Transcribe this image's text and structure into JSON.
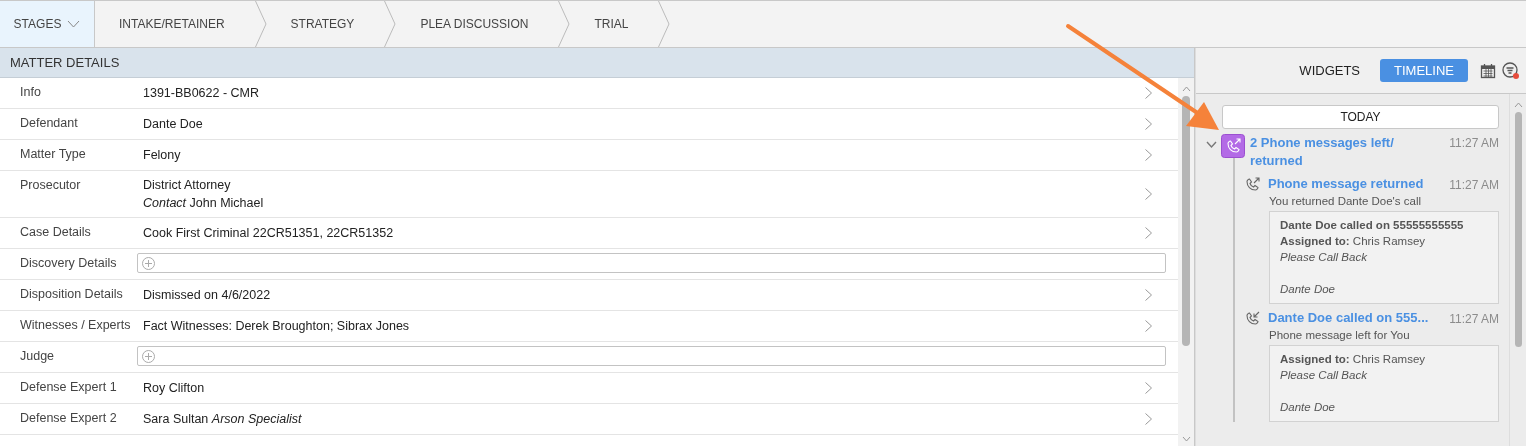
{
  "stages": {
    "menu": {
      "label": "STAGES"
    },
    "items": [
      {
        "label": "INTAKE/RETAINER"
      },
      {
        "label": "STRATEGY"
      },
      {
        "label": "PLEA DISCUSSION"
      },
      {
        "label": "TRIAL"
      }
    ]
  },
  "matter_details": {
    "title": "MATTER DETAILS",
    "rows": [
      {
        "label": "Info",
        "kind": "text",
        "values": [
          "1391-BB0622 - CMR"
        ]
      },
      {
        "label": "Defendant",
        "kind": "text",
        "values": [
          "Dante Doe"
        ]
      },
      {
        "label": "Matter Type",
        "kind": "text",
        "values": [
          "Felony"
        ]
      },
      {
        "label": "Prosecutor",
        "kind": "text",
        "values": [
          "District Attorney",
          "*Contact* John Michael"
        ]
      },
      {
        "label": "Case Details",
        "kind": "text",
        "values": [
          "Cook First Criminal 22CR51351, 22CR51352"
        ]
      },
      {
        "label": "Discovery Details",
        "kind": "add"
      },
      {
        "label": "Disposition Details",
        "kind": "text",
        "values": [
          "Dismissed on 4/6/2022"
        ]
      },
      {
        "label": "Witnesses / Experts",
        "kind": "text",
        "values": [
          "Fact Witnesses: Derek Broughton; Sibrax Jones"
        ]
      },
      {
        "label": "Judge",
        "kind": "add"
      },
      {
        "label": "Defense Expert 1",
        "kind": "text",
        "values": [
          "Roy Clifton"
        ]
      },
      {
        "label": "Defense Expert 2",
        "kind": "text",
        "values": [
          "Sara Sultan *Arson Specialist*"
        ]
      }
    ]
  },
  "side_panel": {
    "tabs": [
      {
        "label": "WIDGETS",
        "selected": false
      },
      {
        "label": "TIMELINE",
        "selected": true
      }
    ],
    "filter_active": true,
    "timeline": {
      "day": "TODAY",
      "groups": [
        {
          "title": "2 Phone messages left/ returned",
          "time": "11:27 AM",
          "expanded": true,
          "entries": [
            {
              "kind": "outgoing",
              "title": "Phone message returned",
              "time": "11:27 AM",
              "subtitle": "You returned Dante Doe's call",
              "note": {
                "lines": [
                  {
                    "kind": "bold",
                    "text": "Dante Doe called on 55555555555"
                  },
                  {
                    "kind": "plain",
                    "text": "**Assigned to:** Chris Ramsey"
                  },
                  {
                    "kind": "italic",
                    "text": "Please Call Back"
                  }
                ],
                "signature": "Dante Doe"
              }
            },
            {
              "kind": "incoming",
              "title": "Dante Doe called on 555...",
              "time": "11:27 AM",
              "subtitle": "Phone message left for You",
              "note": {
                "lines": [
                  {
                    "kind": "plain",
                    "text": "**Assigned to:** Chris Ramsey"
                  },
                  {
                    "kind": "italic",
                    "text": "Please Call Back"
                  }
                ],
                "signature": "Dante Doe"
              }
            }
          ]
        }
      ]
    }
  }
}
